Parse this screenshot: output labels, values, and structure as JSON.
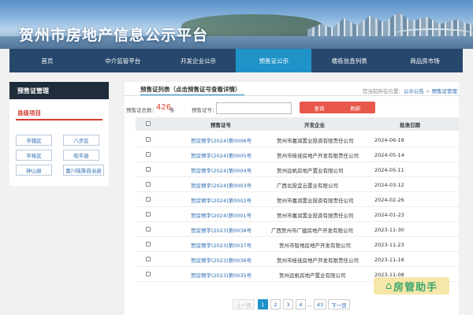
{
  "site": {
    "title": "贺州市房地产信息公示平台"
  },
  "nav": {
    "items": [
      {
        "label": "首页"
      },
      {
        "label": "中介监管平台"
      },
      {
        "label": "开发企业公示"
      },
      {
        "label": "预售证公示",
        "active": true
      },
      {
        "label": "楼栋信息列表"
      },
      {
        "label": "商品房市场"
      }
    ]
  },
  "sidebar": {
    "heading": "预售证管理",
    "section": "县级项目",
    "counties": [
      "市辖区",
      "八步区",
      "平桂区",
      "昭平县",
      "钟山县",
      "富川瑶族自治县"
    ]
  },
  "main": {
    "tab": "预售证列表（点击预售证号查看详情）",
    "breadcrumb": {
      "prefix": "您当前所在位置：",
      "link": "公示公告",
      "sep": " > ",
      "current": "预售证管理"
    },
    "count_label": "预售证总数：",
    "count": "426",
    "count_unit": "条",
    "query_label": "预售证号：",
    "query_value": "",
    "search_btn": "查询",
    "refresh_btn": "刷新",
    "columns": [
      "预售证号",
      "开发企业",
      "批准日期"
    ],
    "rows": [
      {
        "no": "贺房预字(2024)第0006号",
        "dev": "贺州市嘉润置业投资有限责任公司",
        "date": "2024-06-18"
      },
      {
        "no": "贺房预字(2024)第0005号",
        "dev": "贺州市桂佳房地产开发有限责任公司",
        "date": "2024-05-14"
      },
      {
        "no": "贺房预字(2024)第0004号",
        "dev": "贺州远帆房地产置业有限公司",
        "date": "2024-05-11"
      },
      {
        "no": "贺房预字(2024)第0003号",
        "dev": "广西北投宜云置业有限公司",
        "date": "2024-03-12"
      },
      {
        "no": "贺房预字(2024)第0002号",
        "dev": "贺州市嘉润置业投资有限责任公司",
        "date": "2024-02-26"
      },
      {
        "no": "贺房预字(2024)第0001号",
        "dev": "贺州市嘉润置业投资有限责任公司",
        "date": "2024-01-23"
      },
      {
        "no": "贺房预字(2023)第0038号",
        "dev": "广西贺州市广建房地产开发有限公司",
        "date": "2023-11-30"
      },
      {
        "no": "贺房预字(2023)第0037号",
        "dev": "贺州市智地房地产开发有限公司",
        "date": "2023-11-23"
      },
      {
        "no": "贺房预字(2023)第0036号",
        "dev": "贺州市桂佳房地产开发有限责任公司",
        "date": "2023-11-16"
      },
      {
        "no": "贺房预字(2023)第0035号",
        "dev": "贺州远帆房地产置业有限公司",
        "date": "2023-11-08"
      }
    ]
  },
  "pagination": {
    "prev": "上一页",
    "pages": [
      "1",
      "2",
      "3",
      "4",
      "...",
      "43"
    ],
    "current": "1",
    "next": "下一页"
  },
  "watermark": {
    "text": "房管助手"
  }
}
